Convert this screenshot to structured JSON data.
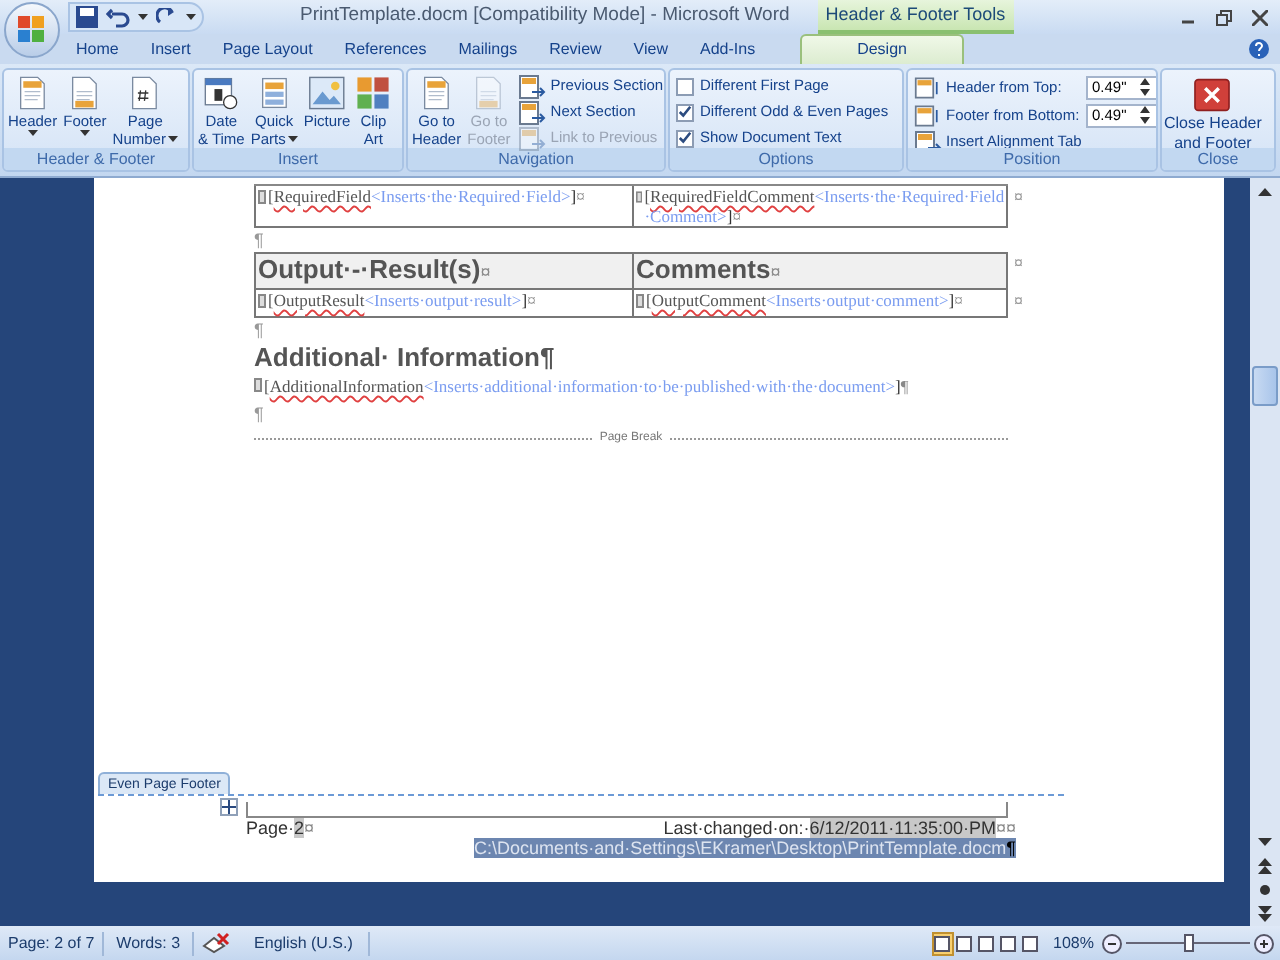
{
  "window": {
    "title": "PrintTemplate.docm [Compatibility Mode] - Microsoft Word",
    "contextual_title": "Header & Footer Tools"
  },
  "tabs": [
    {
      "label": "Home",
      "selected": false
    },
    {
      "label": "Insert",
      "selected": false
    },
    {
      "label": "Page Layout",
      "selected": false
    },
    {
      "label": "References",
      "selected": false
    },
    {
      "label": "Mailings",
      "selected": false
    },
    {
      "label": "Review",
      "selected": false
    },
    {
      "label": "View",
      "selected": false
    },
    {
      "label": "Add-Ins",
      "selected": false
    },
    {
      "label": "Design",
      "selected": true
    }
  ],
  "ribbon_groups": [
    {
      "label": "Header & Footer",
      "items": [
        {
          "kind": "large",
          "lines": [
            "Header"
          ],
          "dropdown": true,
          "disabled": false
        },
        {
          "kind": "large",
          "lines": [
            "Footer"
          ],
          "dropdown": true,
          "disabled": false
        },
        {
          "kind": "large",
          "lines": [
            "Page",
            "Number"
          ],
          "dropdown": true,
          "disabled": false
        }
      ]
    },
    {
      "label": "Insert",
      "items": [
        {
          "kind": "large",
          "lines": [
            "Date",
            "& Time"
          ],
          "dropdown": false,
          "disabled": false
        },
        {
          "kind": "large",
          "lines": [
            "Quick",
            "Parts"
          ],
          "dropdown": true,
          "disabled": false
        },
        {
          "kind": "large",
          "lines": [
            "Picture"
          ],
          "dropdown": false,
          "disabled": false
        },
        {
          "kind": "large",
          "lines": [
            "Clip",
            "Art"
          ],
          "dropdown": false,
          "disabled": false
        }
      ]
    },
    {
      "label": "Navigation",
      "items": [
        {
          "kind": "large",
          "lines": [
            "Go to",
            "Header"
          ],
          "dropdown": false,
          "disabled": false
        },
        {
          "kind": "large",
          "lines": [
            "Go to",
            "Footer"
          ],
          "dropdown": false,
          "disabled": true
        },
        {
          "kind": "small",
          "label": "Previous Section",
          "disabled": false
        },
        {
          "kind": "small",
          "label": "Next Section",
          "disabled": false
        },
        {
          "kind": "small",
          "label": "Link to Previous",
          "disabled": true
        }
      ]
    },
    {
      "label": "Options",
      "items": [
        {
          "kind": "check",
          "label": "Different First Page",
          "checked": false
        },
        {
          "kind": "check",
          "label": "Different Odd & Even Pages",
          "checked": true
        },
        {
          "kind": "check",
          "label": "Show Document Text",
          "checked": true
        }
      ]
    },
    {
      "label": "Position",
      "items": [
        {
          "kind": "spin",
          "label": "Header from Top:",
          "value": "0.49\""
        },
        {
          "kind": "spin",
          "label": "Footer from Bottom:",
          "value": "0.49\""
        },
        {
          "kind": "small",
          "label": "Insert Alignment Tab",
          "disabled": false
        }
      ]
    },
    {
      "label": "Close",
      "items": [
        {
          "kind": "close",
          "lines": [
            "Close Header",
            "and Footer"
          ]
        }
      ]
    }
  ],
  "document": [
    {
      "kind": "table",
      "rows": [
        {
          "header": false,
          "end": "¤",
          "cells": [
            {
              "open": "[",
              "field": "RequiredField",
              "hint": "<Inserts·the·Required·Field>",
              "close": "]",
              "end": "¤"
            },
            {
              "open": "[",
              "field": "RequiredFieldComment",
              "hint": "<Inserts·the·Required·Field·Comment>",
              "close": "]",
              "end": "¤"
            }
          ]
        }
      ]
    },
    {
      "kind": "para",
      "text": "¶"
    },
    {
      "kind": "table",
      "rows": [
        {
          "header": true,
          "end": "¤",
          "cells": [
            {
              "text": "Output·-·Result(s)",
              "end": "¤"
            },
            {
              "text": "Comments",
              "end": "¤"
            }
          ]
        },
        {
          "header": false,
          "end": "¤",
          "cells": [
            {
              "open": "[",
              "field": "OutputResult",
              "hint": "<Inserts·output·result>",
              "close": "]",
              "end": "¤"
            },
            {
              "open": "[",
              "field": "OutputComment",
              "hint": "<Inserts·output·comment>",
              "close": "]",
              "end": "¤"
            }
          ]
        }
      ]
    },
    {
      "kind": "para",
      "text": "¶"
    },
    {
      "kind": "heading",
      "text": "Additional· Information¶"
    },
    {
      "kind": "field",
      "open": "[",
      "field": "AdditionalInformation",
      "hint": "<Inserts·additional·information·to·be·published·with·the·document>",
      "close": "]",
      "end": "¶"
    },
    {
      "kind": "para",
      "text": "¶"
    },
    {
      "kind": "break",
      "text": "Page Break"
    }
  ],
  "footer": {
    "label": "Even Page Footer",
    "page_prefix": "Page·",
    "page_number": "2",
    "page_end": "¤",
    "changed_prefix": "Last·changed·on:·",
    "changed_date": "6/12/2011·11:35:00·PM",
    "changed_end": "¤¤",
    "path": "C:\\Documents·and·Settings\\EKramer\\Desktop\\PrintTemplate.docm",
    "path_end": "¶"
  },
  "status_bar": {
    "page": "Page: 2 of 7",
    "words": "Words: 3",
    "language": "English (U.S.)",
    "zoom": "108%",
    "level": 0.5,
    "views": [
      {
        "selected": true
      },
      {
        "selected": false
      },
      {
        "selected": false
      },
      {
        "selected": false
      },
      {
        "selected": false
      }
    ]
  }
}
